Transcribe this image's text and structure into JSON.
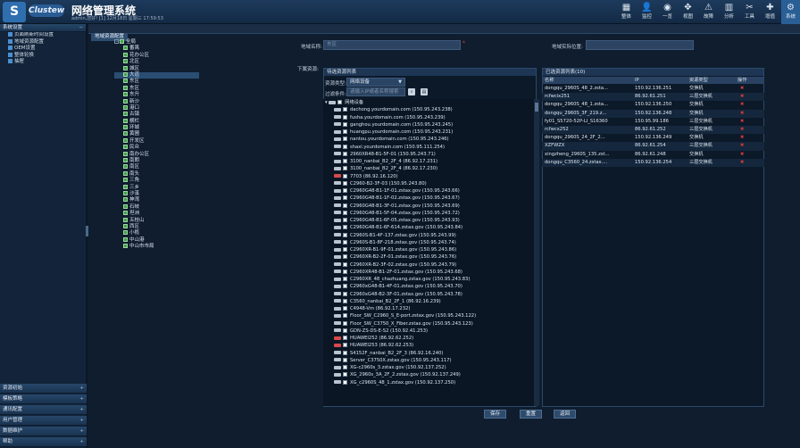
{
  "header": {
    "logo_letter": "S",
    "brand": "Clustew",
    "title": "网络管理系统",
    "userline": "admin,您好! [1] 12月18日 星期三 17:59:53",
    "tools": [
      {
        "icon": "▦",
        "label": "整体",
        "name": "tool-overview"
      },
      {
        "icon": "👤",
        "label": "监控",
        "name": "tool-monitor"
      },
      {
        "icon": "◉",
        "label": "一览",
        "name": "tool-list"
      },
      {
        "icon": "✥",
        "label": "视图",
        "name": "tool-view"
      },
      {
        "icon": "⚠",
        "label": "故障",
        "name": "tool-fault"
      },
      {
        "icon": "▥",
        "label": "分析",
        "name": "tool-analysis"
      },
      {
        "icon": "✂",
        "label": "工具",
        "name": "tool-tools"
      },
      {
        "icon": "✚",
        "label": "增值",
        "name": "tool-addon"
      },
      {
        "icon": "⚙",
        "label": "系统",
        "name": "tool-system"
      }
    ]
  },
  "sidebar": {
    "section_label": "系统设置",
    "items": [
      "页面刷新时间设置",
      "地域资源配置",
      "OEM设置",
      "整体轮换",
      "抽屉"
    ],
    "bottom": [
      "资源初始",
      "模板策略",
      "通讯配置",
      "用户管理",
      "数据维护",
      "帮助"
    ]
  },
  "tab": "地域资源配置",
  "tree": {
    "root": "全局",
    "nodes": [
      "番禺",
      "花办公区",
      "北区",
      "城区",
      "大道",
      "东区",
      "东区",
      "东升",
      "新沙",
      "港口",
      "古镇",
      "横栏",
      "环城",
      "黄圃",
      "开发区",
      "民众",
      "南办公区",
      "南朗",
      "南区",
      "南头",
      "三角",
      "三乡",
      "沙溪",
      "神湾",
      "石岐",
      "坦洲",
      "五桂山",
      "西区",
      "小榄",
      "中山港",
      "中山市市局"
    ],
    "selected_index": 4
  },
  "form": {
    "name_label": "地域名称:",
    "name_value": "东区",
    "pos_label": "地域实际位置:",
    "pos_value": "",
    "under_res": "下属资源:"
  },
  "left_panel": {
    "title": "待选资源列表",
    "type_label": "资源类型:",
    "type_value": "网络设备",
    "filter_label": "过滤条件:",
    "filter_placeholder": "请输入IP或者名称搜索",
    "group": "网络设备",
    "devices": [
      {
        "t": "dachong.yourdomain.com (150.95.243.238)",
        "red": false
      },
      {
        "t": "fusha.yourdomain.com (150.95.243.239)",
        "red": false
      },
      {
        "t": "ganghou.yourdomain.com (150.95.243.245)",
        "red": false
      },
      {
        "t": "huangpu.yourdomain.com (150.95.243.231)",
        "red": false
      },
      {
        "t": "nantou.yourdomain.com (150.95.243.246)",
        "red": false
      },
      {
        "t": "shaxi.yourdomain.com (150.95.111.254)",
        "red": false
      },
      {
        "t": "2960XR48-B1-5F-01 (150.95.243.71)",
        "red": false
      },
      {
        "t": "3100_nanbai_B2_2F_4 (86.92.17.231)",
        "red": false
      },
      {
        "t": "3100_nanbai_B2_2F_4 (86.92.17.230)",
        "red": false
      },
      {
        "t": "7703 (86.92.16.120)",
        "red": true
      },
      {
        "t": "C2960-B2-3F-03 (150.95.243.80)",
        "red": false
      },
      {
        "t": "C2960G48-B1-1F-01.zstax.gov (150.95.243.66)",
        "red": false
      },
      {
        "t": "C2960G48-B1-1F-02.zstax.gov (150.95.243.67)",
        "red": false
      },
      {
        "t": "C2960G48-B1-3F-01.zstax.gov (150.95.243.69)",
        "red": false
      },
      {
        "t": "C2960G48-B1-5F-04.zstax.gov (150.95.243.72)",
        "red": false
      },
      {
        "t": "C2960G48-B1-6F-05.zstax.gov (150.95.243.93)",
        "red": false
      },
      {
        "t": "C2960G48-B1-6F-614.zstax.gov (150.95.243.84)",
        "red": false
      },
      {
        "t": "C2960S-B1-4F-137.zstax.gov (150.95.243.99)",
        "red": false
      },
      {
        "t": "C2960S-B1-8F-218.zstax.gov (150.95.243.74)",
        "red": false
      },
      {
        "t": "C2960XR-B1-9F-01.zstax.gov (150.95.243.86)",
        "red": false
      },
      {
        "t": "C2960XR-B2-2F-01.zstax.gov (150.95.243.76)",
        "red": false
      },
      {
        "t": "C2960XR-B2-3F-02.zstax.gov (150.95.243.79)",
        "red": false
      },
      {
        "t": "C2960XR48-B1-2F-01.zstax.gov (150.95.243.68)",
        "red": false
      },
      {
        "t": "C2960XR_48_chazhuang.zstax.gov (150.95.243.83)",
        "red": false
      },
      {
        "t": "C2960xG48-B1-4F-01.zstax.gov (150.95.243.70)",
        "red": false
      },
      {
        "t": "C2960xG48-B2-3F-01.zstax.gov (150.95.243.78)",
        "red": false
      },
      {
        "t": "C3560_nanbai_B2_2F_1 (86.92.16.239)",
        "red": false
      },
      {
        "t": "C4948-Vm (86.92.17.232)",
        "red": false
      },
      {
        "t": "Floor_SW_C2960_S_E-port.zstax.gov (150.95.243.122)",
        "red": false
      },
      {
        "t": "Floor_SW_C3750_X_Fiber.zstax.gov (150.95.243.123)",
        "red": false
      },
      {
        "t": "GDN-ZS-DS-E-S2 (150.92.41.253)",
        "red": false
      },
      {
        "t": "HUAWEI252 (86.92.62.252)",
        "red": true
      },
      {
        "t": "HUAWEI253 (86.92.62.253)",
        "red": true
      },
      {
        "t": "S4152F_nanbai_B2_2F_3 (86.92.16.240)",
        "red": false
      },
      {
        "t": "Server_C3750X.zstax.gov (150.95.243.117)",
        "red": false
      },
      {
        "t": "XG-c2960s_3.zstax.gov (150.92.137.252)",
        "red": false
      },
      {
        "t": "XG_2960s_3A_2F_2.zstax.gov (150.92.137.249)",
        "red": false
      },
      {
        "t": "XG_c2960S_48_1.zstax.gov (150.92.137.250)",
        "red": false
      }
    ]
  },
  "right_panel": {
    "title": "已选资源列表(10)",
    "cols": [
      "名称",
      "IP",
      "资源类型",
      "操作"
    ],
    "rows": [
      [
        "dongqu_2960S_48_2.zsta...",
        "150.92.136.251",
        "交换机"
      ],
      [
        "rcfwcix251",
        "86.92.61.251",
        "三层交换机"
      ],
      [
        "dongqu_2960S_48_1.zsta...",
        "150.92.136.250",
        "交换机"
      ],
      [
        "dongqu_2960S_3F_219.z...",
        "150.92.136.248",
        "交换机"
      ],
      [
        "fy01_S5720-52P-LI_S16360",
        "150.95.99.186",
        "三层交换机"
      ],
      [
        "rcfwcx252",
        "86.92.61.252",
        "三层交换机"
      ],
      [
        "dongqu_2960S_24_2F_2...",
        "150.92.136.249",
        "交换机"
      ],
      [
        "XZFWZX",
        "86.92.61.254",
        "三层交换机"
      ],
      [
        "xingzheng_2960S_135.zst...",
        "86.92.61.248",
        "交换机"
      ],
      [
        "dongqu_C3560_24.zstax....",
        "150.92.136.254",
        "三层交换机"
      ]
    ]
  },
  "buttons": {
    "save": "保存",
    "reset": "重置",
    "back": "返回"
  }
}
